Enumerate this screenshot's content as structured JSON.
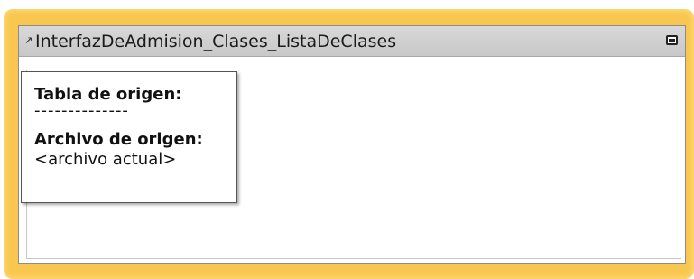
{
  "occurrence": {
    "title": "InterfazDeAdmision_Clases_ListaDeClases",
    "expand_icon": "arrow-expand-icon",
    "collapse_icon": "collapse-box-icon",
    "selection_color": "#f9c74f"
  },
  "source_tooltip": {
    "table_label": "Tabla de origen:",
    "table_value": "--------------",
    "file_label": "Archivo de origen:",
    "file_value": "<archivo actual>"
  }
}
